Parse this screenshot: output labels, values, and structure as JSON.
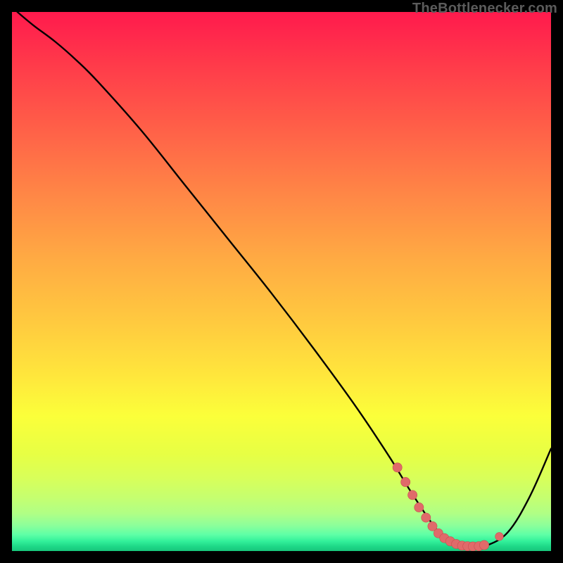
{
  "source_label": "TheBottlenecker.com",
  "colors": {
    "frame": "#000000",
    "curve": "#000000",
    "marker": "#e06a6a",
    "marker_stroke": "#c84f4f"
  },
  "chart_data": {
    "type": "line",
    "title": "",
    "xlabel": "",
    "ylabel": "",
    "xlim": [
      0,
      100
    ],
    "ylim": [
      0,
      100
    ],
    "grid": false,
    "legend": false,
    "series": [
      {
        "name": "bottleneck-curve",
        "x": [
          1,
          4,
          8,
          12,
          16,
          24,
          32,
          40,
          48,
          56,
          64,
          70,
          74,
          78,
          80,
          82,
          84,
          86,
          88,
          92,
          96,
          100
        ],
        "y": [
          100,
          97.5,
          94.5,
          91,
          87,
          78,
          68,
          58,
          48,
          37.5,
          26.5,
          17.5,
          11,
          5,
          2.8,
          1.6,
          1.1,
          0.9,
          1.0,
          3.5,
          10,
          19
        ]
      }
    ],
    "markers": {
      "name": "highlight-dots",
      "points": [
        {
          "x": 71.5,
          "y": 15.5
        },
        {
          "x": 73.0,
          "y": 12.8
        },
        {
          "x": 74.3,
          "y": 10.4
        },
        {
          "x": 75.5,
          "y": 8.1
        },
        {
          "x": 76.8,
          "y": 6.2
        },
        {
          "x": 78.0,
          "y": 4.6
        },
        {
          "x": 79.1,
          "y": 3.3
        },
        {
          "x": 80.2,
          "y": 2.4
        },
        {
          "x": 81.3,
          "y": 1.8
        },
        {
          "x": 82.4,
          "y": 1.3
        },
        {
          "x": 83.5,
          "y": 1.0
        },
        {
          "x": 84.5,
          "y": 0.9
        },
        {
          "x": 85.5,
          "y": 0.85
        },
        {
          "x": 86.6,
          "y": 0.9
        },
        {
          "x": 87.6,
          "y": 1.1
        },
        {
          "x": 90.4,
          "y": 2.7
        }
      ]
    }
  }
}
